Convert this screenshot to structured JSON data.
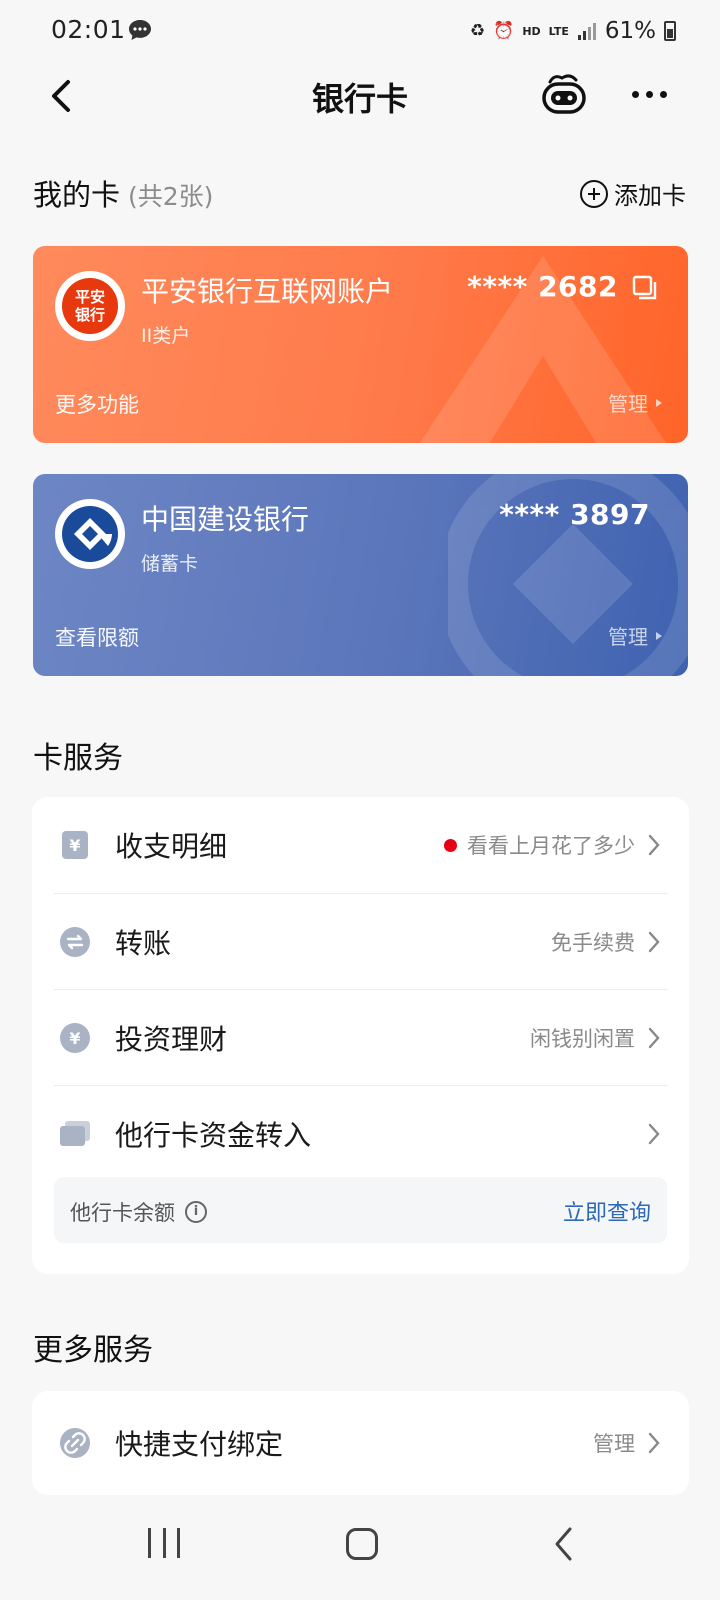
{
  "status_bar": {
    "time": "02:01",
    "hd": "HD",
    "network": "LTE",
    "battery": "61%"
  },
  "nav": {
    "title": "银行卡"
  },
  "my_cards": {
    "title": "我的卡",
    "count": "(共2张)",
    "add_label": "添加卡",
    "cards": [
      {
        "logo_text": "平安银行",
        "bank_name": "平安银行互联网账户",
        "card_type": "II类户",
        "number": "**** 2682",
        "left_action": "更多功能",
        "manage": "管理",
        "color": "#ff7a4a"
      },
      {
        "bank_name": "中国建设银行",
        "card_type": "储蓄卡",
        "number": "**** 3897",
        "left_action": "查看限额",
        "manage": "管理",
        "color": "#5b76bb"
      }
    ]
  },
  "card_services": {
    "title": "卡服务",
    "items": [
      {
        "label": "收支明细",
        "hint": "看看上月花了多少",
        "icon": "yuan-note-icon"
      },
      {
        "label": "转账",
        "hint": "免手续费",
        "icon": "transfer-icon"
      },
      {
        "label": "投资理财",
        "hint": "闲钱别闲置",
        "icon": "yuan-coin-icon"
      },
      {
        "label": "他行卡资金转入",
        "hint": "",
        "icon": "cards-stack-icon"
      }
    ],
    "balance_label": "他行卡余额",
    "balance_action": "立即查询"
  },
  "more_services": {
    "title": "更多服务",
    "items": [
      {
        "label": "快捷支付绑定",
        "hint": "管理",
        "icon": "link-icon"
      }
    ]
  },
  "colors": {
    "accent_link": "#2d69b8",
    "alert_dot": "#e60012",
    "pingan_red": "#e8380d",
    "ccb_blue": "#1a4b9a"
  }
}
